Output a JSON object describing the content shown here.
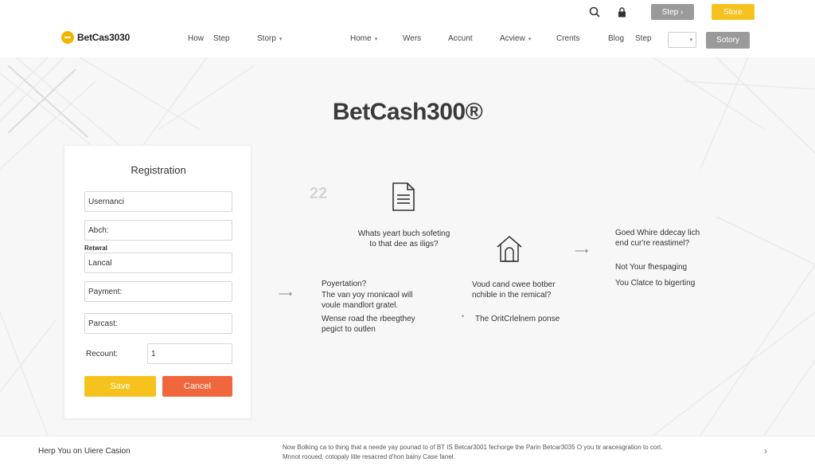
{
  "header": {
    "brand": "BetCas3030",
    "top_actions": {
      "step_button": "Step ›",
      "store_button": "Store"
    },
    "nav": [
      {
        "label": "How",
        "dropdown": false
      },
      {
        "label": "Step",
        "dropdown": false
      },
      {
        "label": "Storp",
        "dropdown": true
      },
      {
        "label": "Home",
        "dropdown": true
      },
      {
        "label": "Wers",
        "dropdown": false
      },
      {
        "label": "Accunt",
        "dropdown": false
      },
      {
        "label": "Acview",
        "dropdown": true
      },
      {
        "label": "Crents",
        "dropdown": false
      },
      {
        "label": "Blog",
        "dropdown": false
      },
      {
        "label": "Step",
        "dropdown": false
      }
    ],
    "select_value": "",
    "cta_button": "Sotory"
  },
  "hero": {
    "title": "BetCash300®"
  },
  "registration": {
    "title": "Registration",
    "fields": {
      "username": "Usernanci",
      "abch": "Abch:",
      "small_label": "Retwral",
      "lancal": "Lancal",
      "payment": "Payment:",
      "parcast": "Parcast:",
      "recount_label": "Recount:",
      "recount_value": "1"
    },
    "save_button": "Save",
    "cancel_button": "Cancel"
  },
  "steps": {
    "number": "22",
    "doc_caption": [
      "Whats yeart buch sofeting",
      "to that dee as iligs?"
    ],
    "left_text": [
      "Poyertation?",
      "The van yoy rnonicaol will",
      "voule mandlort gratel.",
      "Wense road the rbeegthey",
      "pegict to outlen"
    ],
    "middle_text": [
      "Voud cand cwee botber",
      "nchible in the remical?",
      "The OritCrlelnem ponse"
    ],
    "right_text": [
      "Goed Whire ddecay lich",
      "end cur're reastimel?",
      "Not Your fhespaging",
      "You Clatce to bigerting"
    ]
  },
  "footer": {
    "left": "Herp You on Uiere Casion",
    "right_line1": "Now Bolking ca to thing that a neede yay pouriad to of BT IS Betcar3001 fechorge the Parin Betcar3035 O you tir aracesgration to cort.",
    "right_line2": "Mnnot rooued, cotopaly litle resacred d'hon bainy Case fanel."
  },
  "icons": {
    "search": "search-icon",
    "lock": "lock-icon",
    "logo": "coin-logo-icon",
    "document": "document-icon",
    "home": "home-icon",
    "arrow": "arrow-right-icon",
    "footer_chevron": "chevron-right-icon"
  },
  "colors": {
    "accent": "#f6c21e",
    "danger": "#f0663d",
    "neutral_button": "#9a9a9a"
  }
}
